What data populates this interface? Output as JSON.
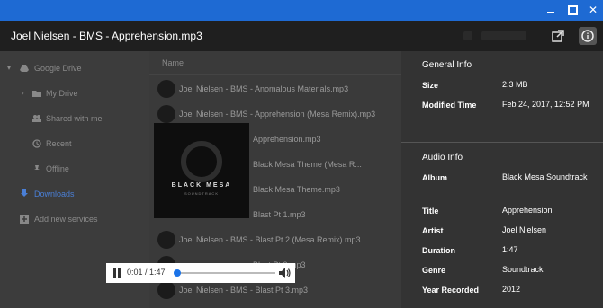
{
  "window": {
    "close_glyph": "✕"
  },
  "header": {
    "title": "Joel Nielsen - BMS - Apprehension.mp3"
  },
  "sidebar": {
    "items": [
      {
        "label": "Google Drive",
        "icon": "google-drive-icon"
      },
      {
        "label": "My Drive",
        "icon": "folder-icon"
      },
      {
        "label": "Shared with me",
        "icon": "people-icon"
      },
      {
        "label": "Recent",
        "icon": "clock-icon"
      },
      {
        "label": "Offline",
        "icon": "pin-icon"
      },
      {
        "label": "Downloads",
        "icon": "download-icon"
      },
      {
        "label": "Add new services",
        "icon": "plus-icon"
      }
    ]
  },
  "filelist": {
    "column_name": "Name",
    "rows": [
      "Joel Nielsen - BMS - Anomalous Materials.mp3",
      "Joel Nielsen - BMS - Apprehension (Mesa Remix).mp3",
      "Apprehension.mp3",
      "Black Mesa Theme (Mesa R...",
      "Black Mesa Theme.mp3",
      "Blast Pt 1.mp3",
      "Joel Nielsen - BMS - Blast Pt 2 (Mesa Remix).mp3",
      "Blast Pt 3.mp3",
      "Joel Nielsen - BMS - Blast Pt 3.mp3"
    ]
  },
  "album_art": {
    "title": "BLACK MESA",
    "subtitle": "SOUNDTRACK"
  },
  "player": {
    "time": "0:01 / 1:47",
    "progress": 0.01
  },
  "info": {
    "general_title": "General Info",
    "general": [
      {
        "label": "Size",
        "value": "2.3 MB"
      },
      {
        "label": "Modified Time",
        "value": "Feb 24, 2017, 12:52 PM"
      }
    ],
    "audio_title": "Audio Info",
    "audio": [
      {
        "label": "Album",
        "value": "Black Mesa Soundtrack"
      },
      {
        "label": "Title",
        "value": "Apprehension"
      },
      {
        "label": "Artist",
        "value": "Joel Nielsen"
      },
      {
        "label": "Duration",
        "value": "1:47"
      },
      {
        "label": "Genre",
        "value": "Soundtrack"
      },
      {
        "label": "Year Recorded",
        "value": "2012"
      }
    ]
  }
}
